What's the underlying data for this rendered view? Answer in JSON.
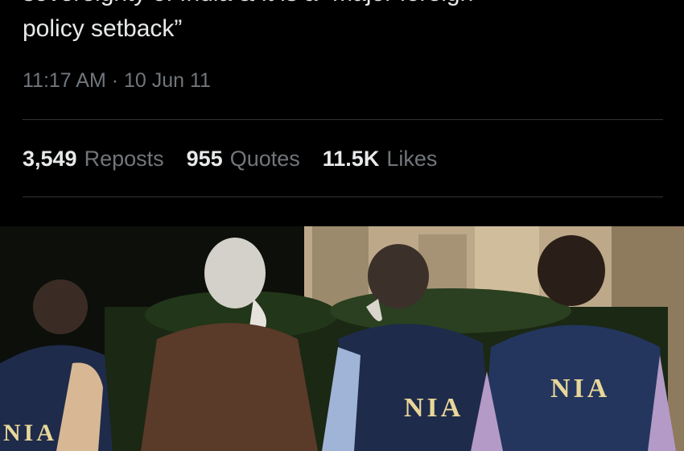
{
  "tweet": {
    "text_line1": "sovereignty of India & it is a “major foreign",
    "text_line2": "policy setback”",
    "timestamp": "11:17 AM · 10 Jun 11"
  },
  "stats": {
    "reposts_count": "3,549",
    "reposts_label": "Reposts",
    "quotes_count": "955",
    "quotes_label": "Quotes",
    "likes_count": "11.5K",
    "likes_label": "Likes"
  },
  "photo": {
    "vest_text": "NIA",
    "vest_color": "#1f2b4a",
    "vest_text_color": "#e8d79a"
  }
}
